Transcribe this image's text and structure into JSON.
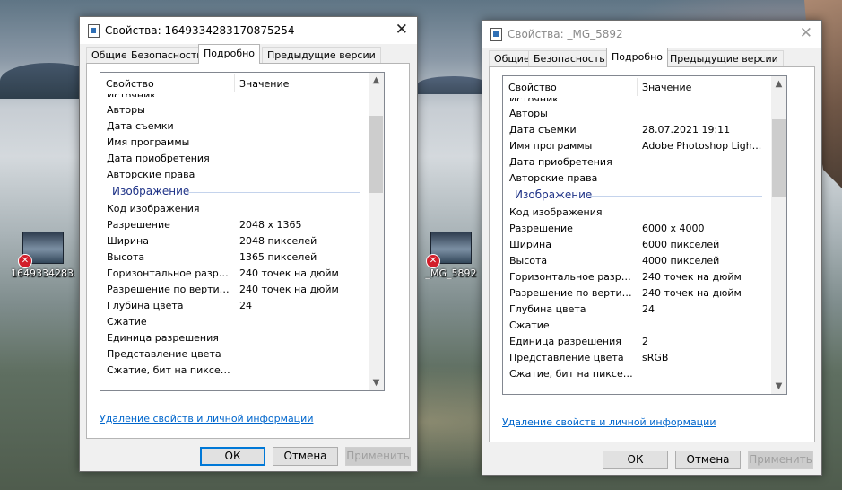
{
  "desktop": {
    "icons": [
      {
        "label": "1649334283..."
      },
      {
        "label": "_MG_5892"
      }
    ]
  },
  "win1": {
    "title": "Свойства: 1649334283170875254",
    "tabs": [
      "Общие",
      "Безопасность",
      "Подробно",
      "Предыдущие версии"
    ],
    "active_tab": "Подробно",
    "col_property": "Свойство",
    "col_value": "Значение",
    "peek_text": "Источник",
    "rows_top": [
      {
        "name": "Авторы",
        "value": ""
      },
      {
        "name": "Дата съемки",
        "value": ""
      },
      {
        "name": "Имя программы",
        "value": ""
      },
      {
        "name": "Дата приобретения",
        "value": ""
      },
      {
        "name": "Авторские права",
        "value": ""
      }
    ],
    "group_title": "Изображение",
    "rows_image": [
      {
        "name": "Код изображения",
        "value": ""
      },
      {
        "name": "Разрешение",
        "value": "2048 x 1365"
      },
      {
        "name": "Ширина",
        "value": "2048 пикселей"
      },
      {
        "name": "Высота",
        "value": "1365 пикселей"
      },
      {
        "name": "Горизонтальное разреше...",
        "value": "240 точек на дюйм"
      },
      {
        "name": "Разрешение по вертикали",
        "value": "240 точек на дюйм"
      },
      {
        "name": "Глубина цвета",
        "value": "24"
      },
      {
        "name": "Сжатие",
        "value": ""
      },
      {
        "name": "Единица разрешения",
        "value": ""
      },
      {
        "name": "Представление цвета",
        "value": ""
      },
      {
        "name": "Сжатие, бит на пиксель",
        "value": ""
      }
    ],
    "remove_link": "Удаление свойств и личной информации",
    "ok": "ОК",
    "cancel": "Отмена",
    "apply": "Применить"
  },
  "win2": {
    "title": "Свойства: _MG_5892",
    "tabs": [
      "Общие",
      "Безопасность",
      "Подробно",
      "Предыдущие версии"
    ],
    "active_tab": "Подробно",
    "col_property": "Свойство",
    "col_value": "Значение",
    "peek_text": "Источник",
    "rows_top": [
      {
        "name": "Авторы",
        "value": ""
      },
      {
        "name": "Дата съемки",
        "value": "28.07.2021 19:11"
      },
      {
        "name": "Имя программы",
        "value": "Adobe Photoshop Ligh..."
      },
      {
        "name": "Дата приобретения",
        "value": ""
      },
      {
        "name": "Авторские права",
        "value": ""
      }
    ],
    "group_title": "Изображение",
    "rows_image": [
      {
        "name": "Код изображения",
        "value": ""
      },
      {
        "name": "Разрешение",
        "value": "6000 x 4000"
      },
      {
        "name": "Ширина",
        "value": "6000 пикселей"
      },
      {
        "name": "Высота",
        "value": "4000 пикселей"
      },
      {
        "name": "Горизонтальное разреше...",
        "value": "240 точек на дюйм"
      },
      {
        "name": "Разрешение по вертикали",
        "value": "240 точек на дюйм"
      },
      {
        "name": "Глубина цвета",
        "value": "24"
      },
      {
        "name": "Сжатие",
        "value": ""
      },
      {
        "name": "Единица разрешения",
        "value": "2"
      },
      {
        "name": "Представление цвета",
        "value": "sRGB"
      },
      {
        "name": "Сжатие, бит на пиксель",
        "value": ""
      }
    ],
    "remove_link": "Удаление свойств и личной информации",
    "ok": "ОК",
    "cancel": "Отмена",
    "apply": "Применить"
  },
  "icons": {
    "file": "file-icon",
    "close": "close-icon",
    "error_badge": "error-badge-icon",
    "scroll_up": "scroll-up-icon",
    "scroll_down": "scroll-down-icon"
  }
}
